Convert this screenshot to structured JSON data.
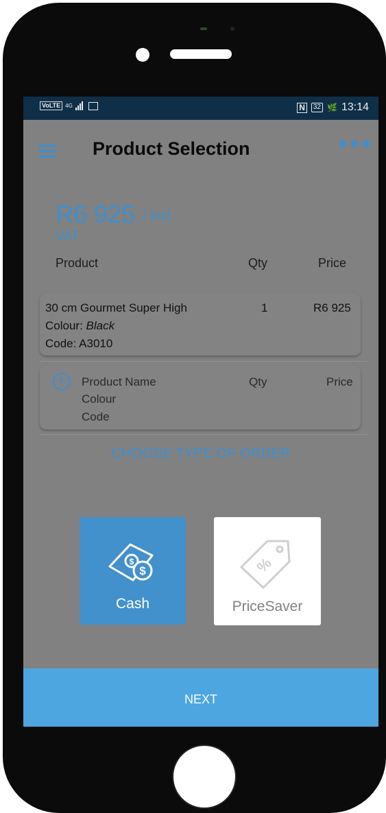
{
  "statusbar": {
    "volte": "VoLTE",
    "network": "4G",
    "nfc": "N",
    "battery": "32",
    "time": "13:14"
  },
  "header": {
    "title": "Product Selection"
  },
  "total": {
    "price": "R6 925",
    "suffix": "/ incl.",
    "vat": "VAT"
  },
  "columns": {
    "product": "Product",
    "qty": "Qty",
    "price": "Price"
  },
  "items": [
    {
      "name": "30 cm Gourmet Super High",
      "qty": "1",
      "price": "R6 925",
      "colour_label": "Colour:",
      "colour": "Black",
      "code": "Code: A3010"
    }
  ],
  "new_item": {
    "name": "Product Name",
    "qty": "Qty",
    "price": "Price",
    "colour": "Colour",
    "code": "Code"
  },
  "order": {
    "heading": "CHOOSE TYPE OF ORDER",
    "options": [
      {
        "label": "Cash",
        "icon": "cash-icon",
        "selected": true
      },
      {
        "label": "PriceSaver",
        "icon": "price-tag-icon",
        "selected": false
      }
    ]
  },
  "footer": {
    "next_label": "NEXT"
  },
  "colors": {
    "accent": "#3d8fd0",
    "next_button": "#4da6e0",
    "statusbar": "#0f2f48",
    "overlay": "#818181"
  }
}
